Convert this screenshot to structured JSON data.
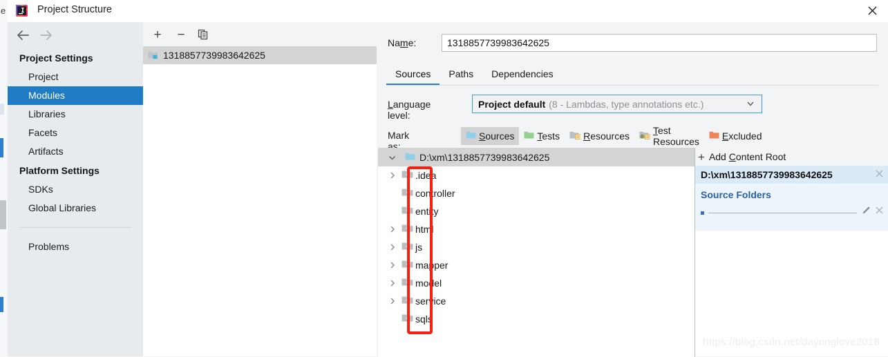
{
  "window": {
    "title": "Project Structure",
    "app_icon": "intellij-idea-icon",
    "close_label": "✕"
  },
  "nav": {
    "back_icon": "arrow-left-icon",
    "forward_icon": "arrow-right-icon",
    "groups": [
      {
        "title": "Project Settings",
        "items": [
          {
            "label": "Project",
            "selected": false
          },
          {
            "label": "Modules",
            "selected": true
          },
          {
            "label": "Libraries",
            "selected": false
          },
          {
            "label": "Facets",
            "selected": false
          },
          {
            "label": "Artifacts",
            "selected": false
          }
        ]
      },
      {
        "title": "Platform Settings",
        "items": [
          {
            "label": "SDKs",
            "selected": false
          },
          {
            "label": "Global Libraries",
            "selected": false
          }
        ]
      }
    ],
    "extra": [
      {
        "label": "Problems",
        "selected": false
      }
    ]
  },
  "module_list": {
    "toolbar": {
      "add_label": "+",
      "remove_label": "−",
      "copy_icon": "copy-icon"
    },
    "rows": [
      {
        "label": "1318857739983642625",
        "icon": "module-folder-icon",
        "selected": true
      }
    ]
  },
  "detail": {
    "name_label": "Na",
    "name_label_mnemonic": "m",
    "name_label_rest": "e:",
    "name_value": "1318857739983642625",
    "tabs": [
      {
        "label": "Sources",
        "active": true
      },
      {
        "label": "Paths",
        "active": false
      },
      {
        "label": "Dependencies",
        "active": false
      }
    ],
    "language_level": {
      "label_mnemonic": "L",
      "label_rest": "anguage level:",
      "selected": "Project default",
      "hint": "(8 - Lambdas, type annotations etc.)",
      "chevron_icon": "chevron-down-icon"
    },
    "mark_as": {
      "label": "Mark as:",
      "buttons": [
        {
          "pre": "",
          "mn": "S",
          "post": "ources",
          "icon": "sources-folder-icon",
          "pressed": true
        },
        {
          "pre": "",
          "mn": "T",
          "post": "ests",
          "icon": "tests-folder-icon",
          "pressed": false
        },
        {
          "pre": "",
          "mn": "R",
          "post": "esources",
          "icon": "resources-folder-icon",
          "pressed": false
        },
        {
          "pre": "",
          "mn": "T",
          "post": "est Resources",
          "icon": "test-resources-folder-icon",
          "pressed": false
        },
        {
          "pre": "",
          "mn": "E",
          "post": "xcluded",
          "icon": "excluded-folder-icon",
          "pressed": false
        }
      ]
    },
    "tree": {
      "root": {
        "label": "D:\\xm\\1318857739983642625",
        "expanded": true,
        "icon": "content-root-folder-icon",
        "twisty_icon": "chevron-down-icon"
      },
      "rows": [
        {
          "label": ".idea",
          "has_twisty": true,
          "icon": "folder-icon"
        },
        {
          "label": "controller",
          "has_twisty": false,
          "icon": "folder-icon"
        },
        {
          "label": "entity",
          "has_twisty": false,
          "icon": "folder-icon"
        },
        {
          "label": "html",
          "has_twisty": true,
          "icon": "folder-icon"
        },
        {
          "label": "js",
          "has_twisty": true,
          "icon": "folder-icon"
        },
        {
          "label": "mapper",
          "has_twisty": true,
          "icon": "folder-icon"
        },
        {
          "label": "model",
          "has_twisty": true,
          "icon": "folder-icon"
        },
        {
          "label": "service",
          "has_twisty": true,
          "icon": "folder-icon"
        },
        {
          "label": "sqls",
          "has_twisty": false,
          "icon": "folder-icon"
        }
      ]
    },
    "content_root": {
      "add_pre": "Add ",
      "add_mn": "C",
      "add_post": "ontent Root",
      "add_icon": "plus-icon",
      "path": "D:\\xm\\1318857739983642625",
      "remove_icon": "close-icon",
      "source_folders_title": "Source Folders",
      "source_folder_rows": [
        {
          "value": "",
          "edit_icon": "pencil-icon",
          "remove_icon": "close-icon"
        }
      ]
    }
  },
  "annotation": {
    "highlight_color": "#fc1f0d"
  },
  "watermark": {
    "text": "https://blog.csdn.net/dayonglove2018"
  }
}
